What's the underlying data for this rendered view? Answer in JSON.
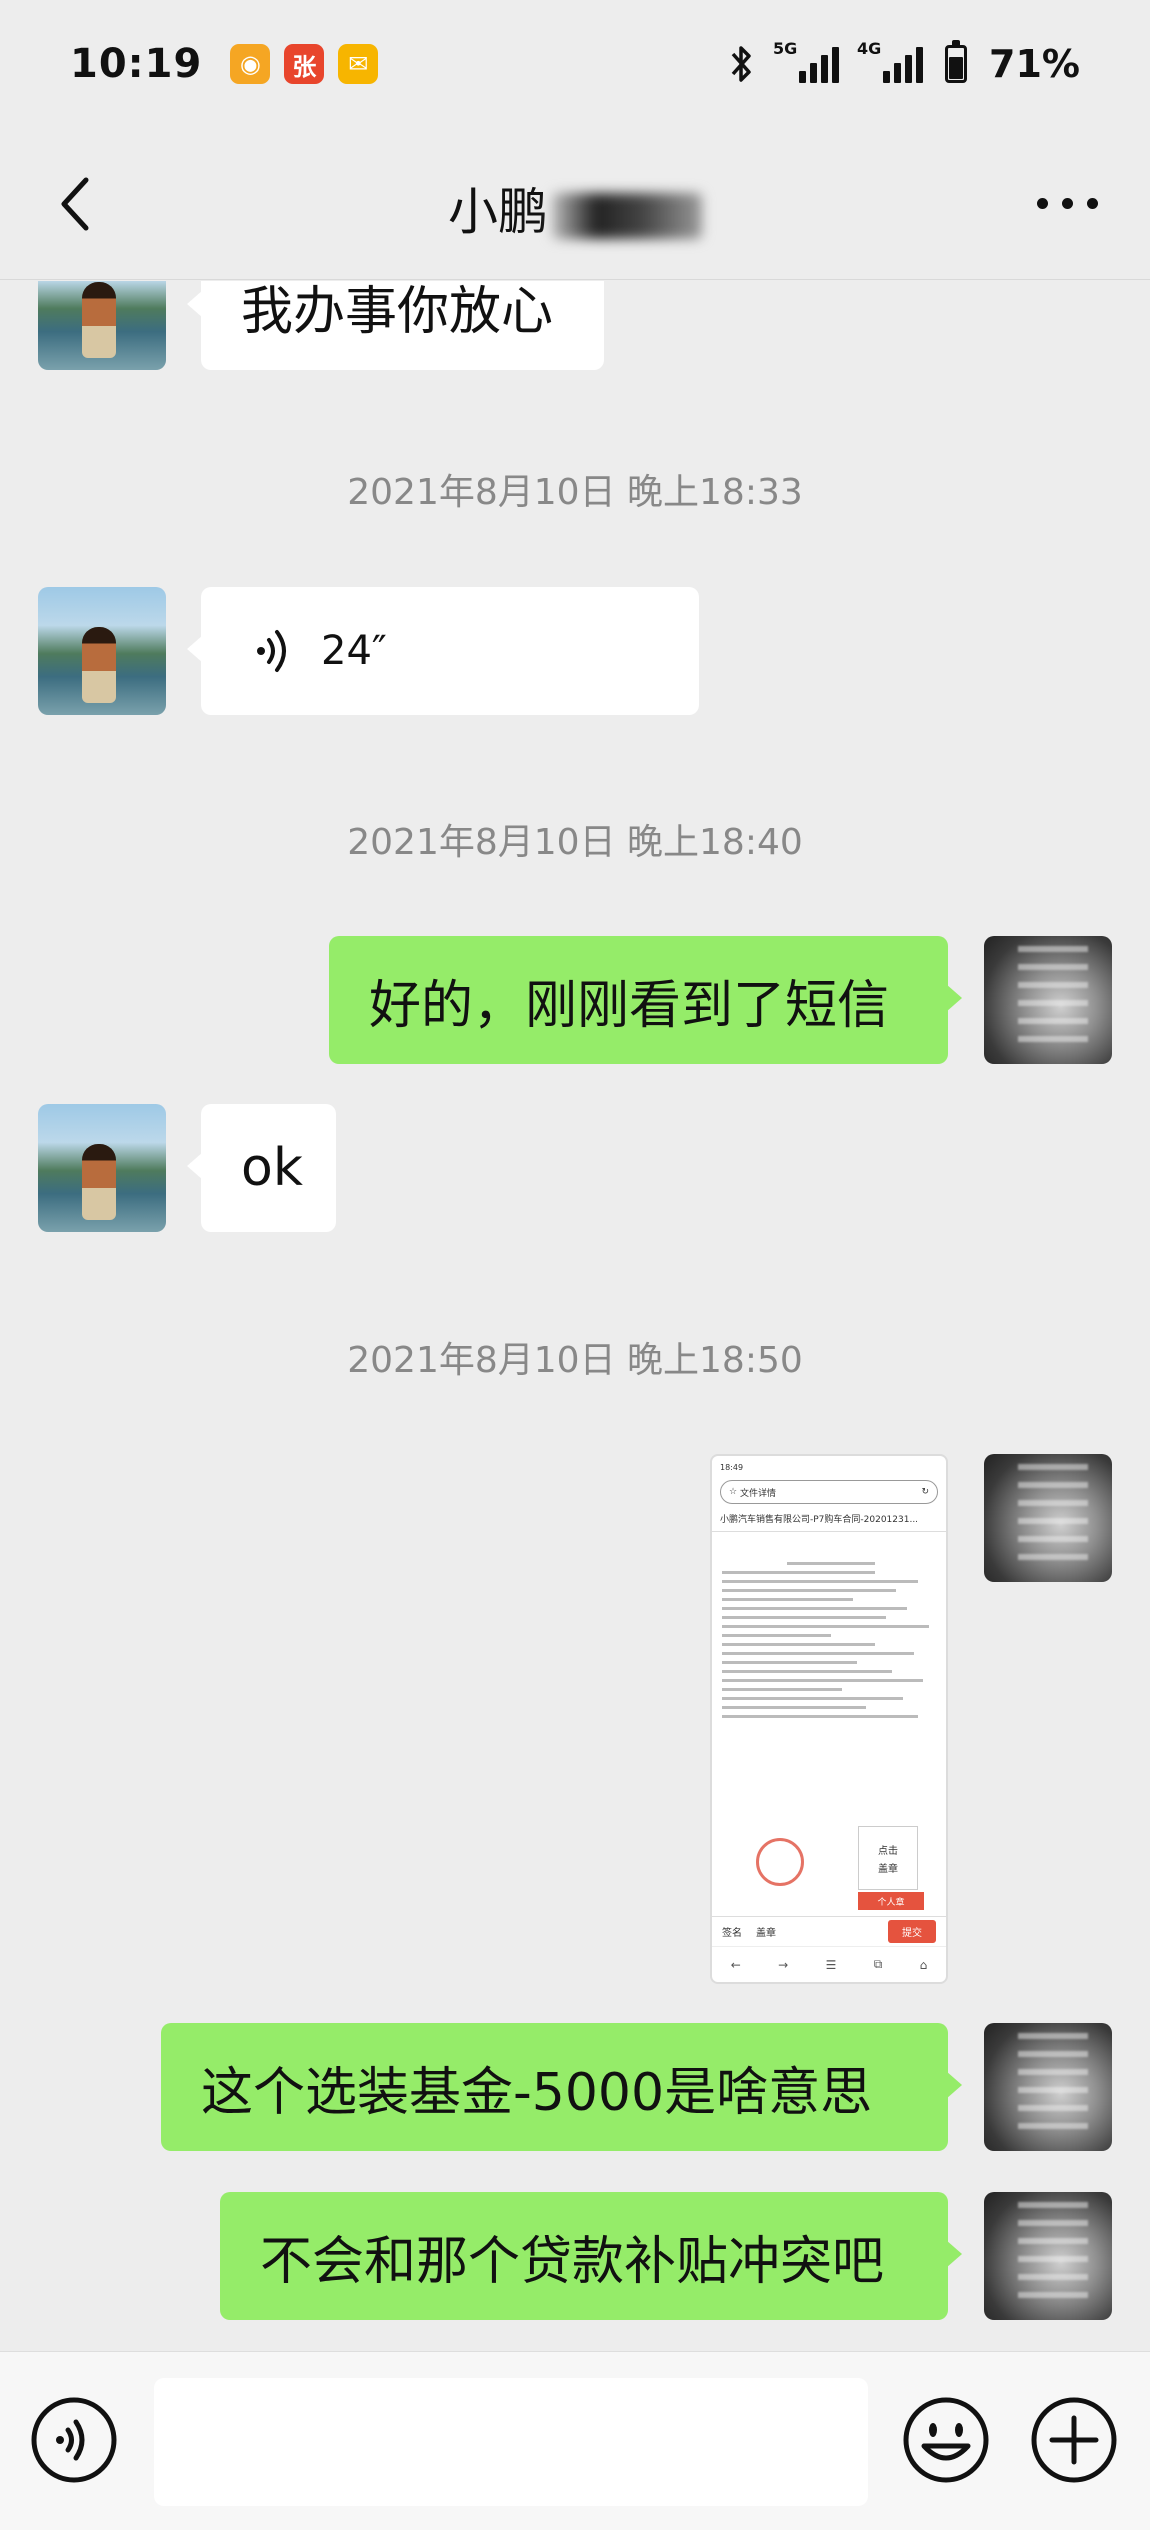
{
  "status_bar": {
    "time": "10:19",
    "apps": [
      {
        "name": "weibo-icon",
        "glyph": "◉",
        "color": "#f5a623"
      },
      {
        "name": "zhang-app-icon",
        "glyph": "张",
        "color": "#e8452c"
      },
      {
        "name": "mail-app-icon",
        "glyph": "✉",
        "color": "#f7b500"
      }
    ],
    "signal_5g": "5G",
    "signal_4g": "4G",
    "battery": "71%"
  },
  "header": {
    "title": "小鹏"
  },
  "messages": {
    "m1": {
      "sender": "them",
      "text": "我办事你放心"
    },
    "ts1": "2021年8月10日 晚上18:33",
    "m2": {
      "sender": "them",
      "type": "voice",
      "duration": "24″"
    },
    "ts2": "2021年8月10日 晚上18:40",
    "m3": {
      "sender": "me",
      "text": "好的，刚刚看到了短信"
    },
    "m4": {
      "sender": "them",
      "text": "ok"
    },
    "ts3": "2021年8月10日 晚上18:50",
    "m5": {
      "sender": "me",
      "type": "image",
      "screenshot": {
        "time": "18:49",
        "search_text": "文件详情",
        "doc_title": "小鹏汽车销售有限公司-P7购车合同-20201231...",
        "sign_box_line1": "点击",
        "sign_box_line2": "盖章",
        "red_tag": "个人章",
        "sign_label": "签名",
        "seal_label": "盖章",
        "submit_label": "提交"
      }
    },
    "m6": {
      "sender": "me",
      "text": "这个选装基金-5000是啥意思"
    },
    "m7": {
      "sender": "me",
      "text": "不会和那个贷款补贴冲突吧"
    }
  },
  "input_bar": {
    "placeholder": ""
  }
}
